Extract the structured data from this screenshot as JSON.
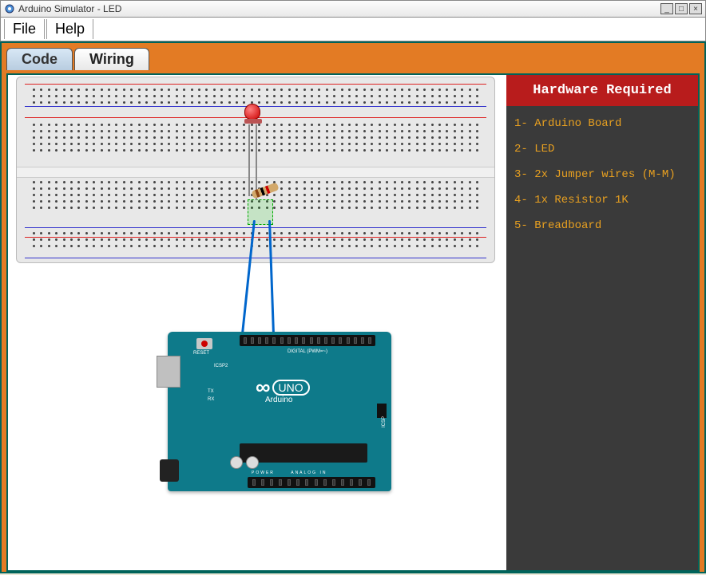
{
  "window": {
    "title": "Arduino Simulator - LED"
  },
  "menu": {
    "file": "File",
    "help": "Help"
  },
  "tabs": {
    "code": "Code",
    "wiring": "Wiring"
  },
  "sidebar": {
    "header": "Hardware Required",
    "items": [
      "1- Arduino Board",
      "2- LED",
      "3- 2x Jumper wires (M-M)",
      "4- 1x Resistor 1K",
      "5- Breadboard"
    ]
  },
  "arduino": {
    "reset": "RESET",
    "digital": "DIGITAL (PWM=~)",
    "brand": "Arduino",
    "uno": "UNO",
    "tx": "TX",
    "rx": "RX",
    "icsp": "ICSP",
    "icsp2": "ICSP2",
    "power_lbl": "POWER",
    "analog_lbl": "ANALOG IN"
  }
}
